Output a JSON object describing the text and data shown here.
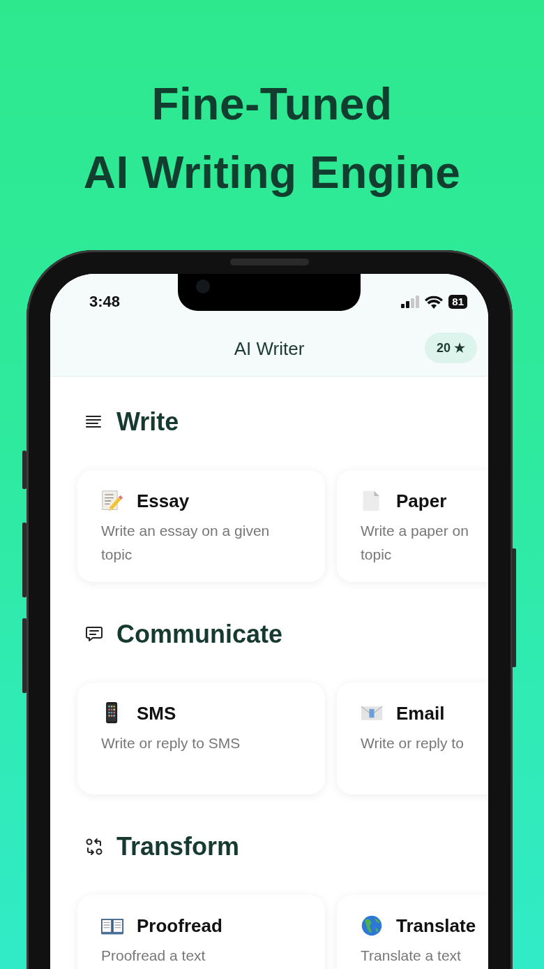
{
  "headline": [
    "Fine-Tuned",
    "AI Writing Engine"
  ],
  "status_bar": {
    "time": "3:48",
    "battery": "81"
  },
  "header": {
    "title": "AI Writer",
    "credits": "20 ★"
  },
  "sections": [
    {
      "title": "Write",
      "kind": "lines",
      "cards": [
        {
          "title": "Essay",
          "kind": "memo",
          "description": [
            "Write an essay on a given",
            "topic"
          ]
        },
        {
          "title": "Paper",
          "kind": "page",
          "description": [
            "Write a paper on",
            "topic"
          ]
        }
      ]
    },
    {
      "title": "Communicate",
      "kind": "chat",
      "cards": [
        {
          "title": "SMS",
          "kind": "phone",
          "description": [
            "Write or reply to SMS"
          ]
        },
        {
          "title": "Email",
          "kind": "envelope",
          "description": [
            "Write or reply to"
          ]
        }
      ]
    },
    {
      "title": "Transform",
      "kind": "swap",
      "cards": [
        {
          "title": "Proofread",
          "kind": "book",
          "description": [
            "Proofread a text"
          ]
        },
        {
          "title": "Translate",
          "kind": "globe",
          "description": [
            "Translate a text"
          ]
        }
      ]
    }
  ]
}
